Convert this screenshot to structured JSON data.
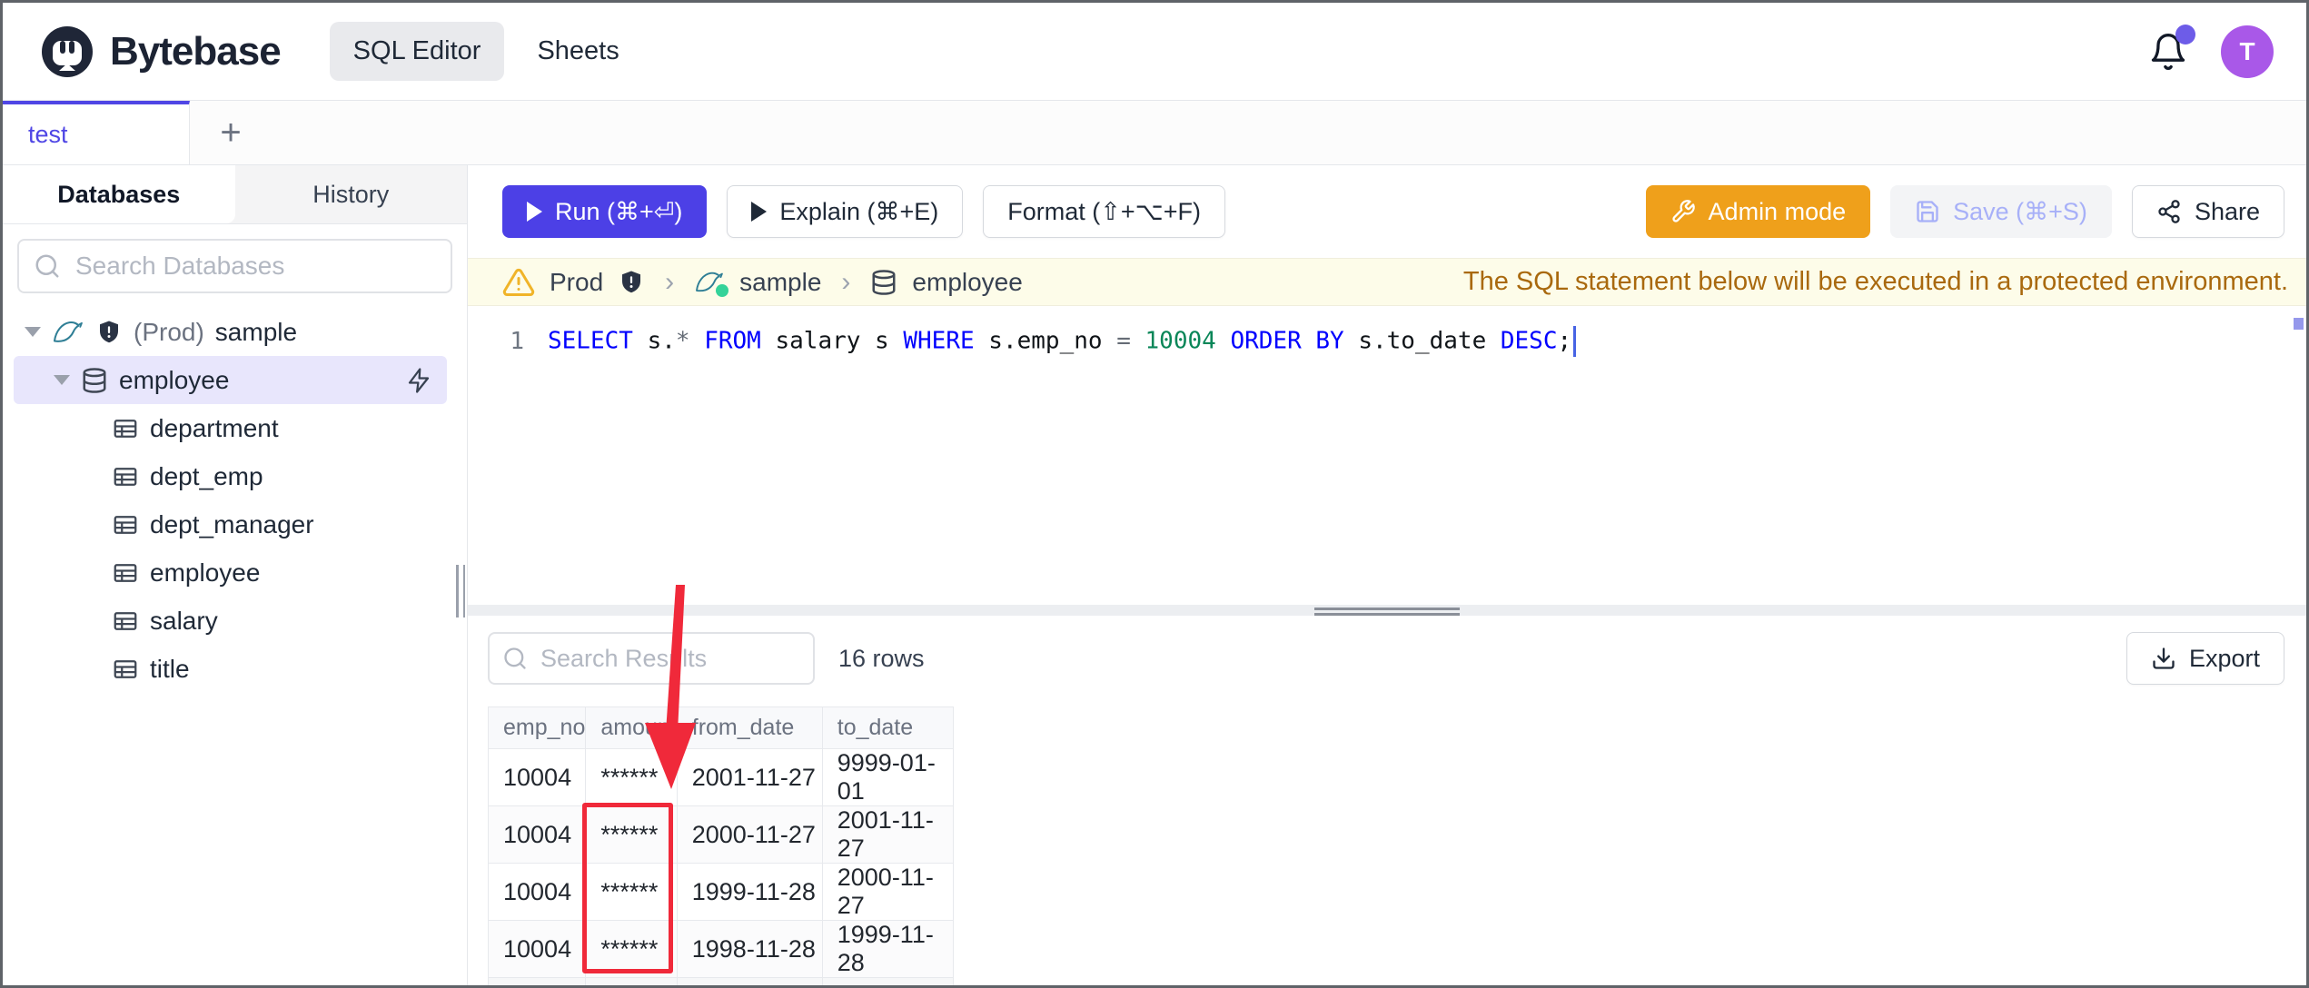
{
  "header": {
    "brand": "Bytebase",
    "nav_sql_editor": "SQL Editor",
    "nav_sheets": "Sheets",
    "avatar_text": "T"
  },
  "worksheet_tabs": {
    "active_label": "test",
    "add_label": "+"
  },
  "sidebar": {
    "tab_databases": "Databases",
    "tab_history": "History",
    "search_placeholder": "Search Databases",
    "tree": {
      "instance_env": "(Prod)",
      "instance_name": "sample",
      "database_name": "employee",
      "tables": [
        "department",
        "dept_emp",
        "dept_manager",
        "employee",
        "salary",
        "title"
      ]
    }
  },
  "toolbar": {
    "run_label": "Run (⌘+⏎)",
    "explain_label": "Explain (⌘+E)",
    "format_label": "Format (⇧+⌥+F)",
    "admin_label": "Admin mode",
    "save_label": "Save (⌘+S)",
    "share_label": "Share"
  },
  "protected_bar": {
    "env": "Prod",
    "database": "sample",
    "table": "employee",
    "notice": "The SQL statement below will be executed in a protected environment."
  },
  "editor": {
    "line_number": "1",
    "tokens": [
      {
        "text": "SELECT",
        "type": "keyword"
      },
      {
        "text": " s.",
        "type": "plain"
      },
      {
        "text": "*",
        "type": "operator"
      },
      {
        "text": " ",
        "type": "plain"
      },
      {
        "text": "FROM",
        "type": "keyword"
      },
      {
        "text": " salary s ",
        "type": "plain"
      },
      {
        "text": "WHERE",
        "type": "keyword"
      },
      {
        "text": " s.emp_no ",
        "type": "plain"
      },
      {
        "text": "=",
        "type": "operator"
      },
      {
        "text": " ",
        "type": "plain"
      },
      {
        "text": "10004",
        "type": "number"
      },
      {
        "text": " ",
        "type": "plain"
      },
      {
        "text": "ORDER BY",
        "type": "keyword"
      },
      {
        "text": " s.to_date ",
        "type": "plain"
      },
      {
        "text": "DESC",
        "type": "keyword"
      },
      {
        "text": ";",
        "type": "plain"
      }
    ]
  },
  "results": {
    "search_placeholder": "Search Results",
    "row_count": "16 rows",
    "export_label": "Export",
    "columns": [
      "emp_no",
      "amount",
      "from_date",
      "to_date"
    ],
    "rows": [
      [
        "10004",
        "******",
        "2001-11-27",
        "9999-01-01"
      ],
      [
        "10004",
        "******",
        "2000-11-27",
        "2001-11-27"
      ],
      [
        "10004",
        "******",
        "1999-11-28",
        "2000-11-27"
      ],
      [
        "10004",
        "******",
        "1998-11-28",
        "1999-11-28"
      ]
    ]
  },
  "colors": {
    "accent_indigo": "#4f46e5",
    "run_button": "#4c40e6",
    "admin_orange": "#efa01b",
    "avatar_purple": "#a958e8",
    "notification_dot": "#6d5ce8",
    "annotation_red": "#f0293a",
    "keyword_blue": "#0101fe",
    "number_green": "#098658",
    "notice_amber": "#a9690e",
    "protected_bg": "#fdfce9",
    "tree_highlight": "#e8e6fc",
    "status_green": "#34d399"
  }
}
